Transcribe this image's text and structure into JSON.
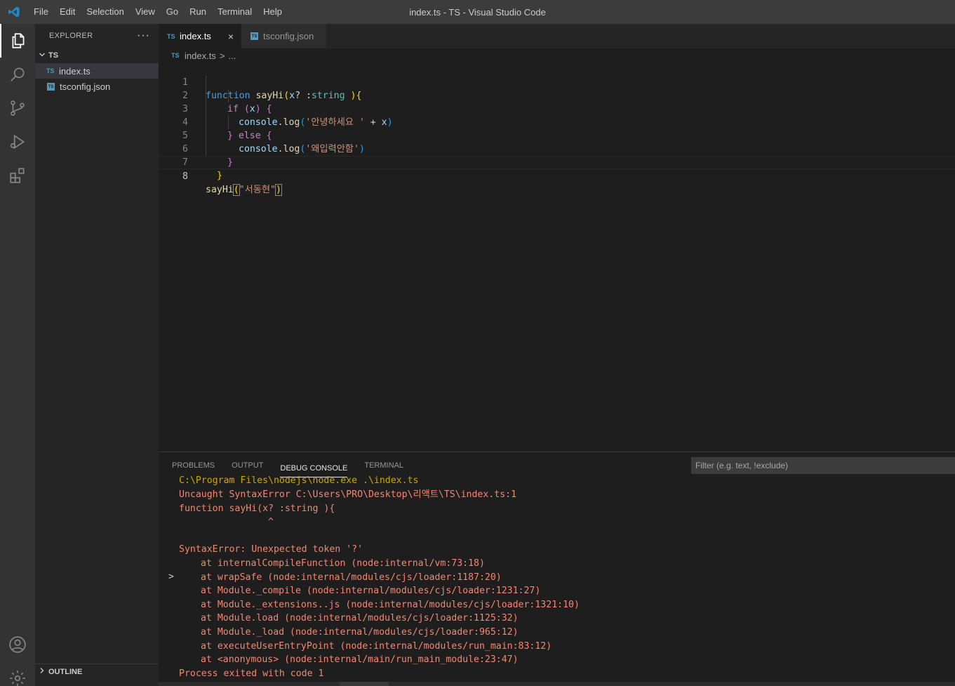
{
  "window": {
    "title": "index.ts - TS - Visual Studio Code",
    "menu": [
      "File",
      "Edit",
      "Selection",
      "View",
      "Go",
      "Run",
      "Terminal",
      "Help"
    ]
  },
  "activity_bar": {
    "items": [
      "files-icon",
      "search-icon",
      "source-control-icon",
      "run-debug-icon",
      "extensions-icon"
    ],
    "bottom": [
      "account-icon",
      "settings-gear-icon"
    ]
  },
  "sidebar": {
    "header": "EXPLORER",
    "more": "···",
    "folder": "TS",
    "files": [
      {
        "badge": "TS",
        "name": "index.ts",
        "selected": true
      },
      {
        "badge": "TS",
        "name": "tsconfig.json",
        "selected": false
      }
    ],
    "outline": "OUTLINE"
  },
  "tabs": [
    {
      "badge": "TS",
      "label": "index.ts",
      "active": true,
      "close": "×"
    },
    {
      "badge": "TS",
      "label": "tsconfig.json",
      "active": false
    }
  ],
  "breadcrumb": {
    "badge": "TS",
    "file": "index.ts",
    "sep": ">",
    "more": "..."
  },
  "editor": {
    "line_numbers": [
      "1",
      "2",
      "3",
      "4",
      "5",
      "6",
      "7",
      "8"
    ],
    "current_line": "8",
    "code": {
      "l1": {
        "kw": "function",
        "fn": "sayHi",
        "open": "(",
        "param": "x",
        "rest": "? :",
        "type": "string",
        "close": " )",
        "brace": "{"
      },
      "l2": {
        "kw": "if",
        "open": " (",
        "var": "x",
        "close": ")",
        "brace": " {"
      },
      "l3": {
        "obj": "console",
        "dot": ".",
        "fn": "log",
        "open": "(",
        "str": "'안녕하세요 '",
        "op": " + ",
        "var": "x",
        "close": ")"
      },
      "l4": {
        "brace1": "}",
        "kw": " else ",
        "brace2": "{"
      },
      "l5": {
        "obj": "console",
        "dot": ".",
        "fn": "log",
        "open": "(",
        "str": "'왜입력안함'",
        "close": ")"
      },
      "l6": {
        "brace": "}"
      },
      "l7": {
        "brace": "}"
      },
      "l8": {
        "fn": "sayHi",
        "open": "(",
        "str": "\"서동현\"",
        "close": ")"
      }
    }
  },
  "panel": {
    "tabs": [
      "PROBLEMS",
      "OUTPUT",
      "DEBUG CONSOLE",
      "TERMINAL"
    ],
    "active_tab": "DEBUG CONSOLE",
    "filter_placeholder": "Filter (e.g. text, !exclude)",
    "expander": ">",
    "console": [
      "C:\\Program Files\\nodejs\\node.exe .\\index.ts",
      "Uncaught SyntaxError C:\\Users\\PRO\\Desktop\\리액트\\TS\\index.ts:1",
      "function sayHi(x? :string ){",
      "                ^",
      "",
      "SyntaxError: Unexpected token '?'",
      "at internalCompileFunction (node:internal/vm:73:18)",
      "at wrapSafe (node:internal/modules/cjs/loader:1187:20)",
      "at Module._compile (node:internal/modules/cjs/loader:1231:27)",
      "at Module._extensions..js (node:internal/modules/cjs/loader:1321:10)",
      "at Module.load (node:internal/modules/cjs/loader:1125:32)",
      "at Module._load (node:internal/modules/cjs/loader:965:12)",
      "at executeUserEntryPoint (node:internal/modules/run_main:83:12)",
      "at <anonymous> (node:internal/main/run_main_module:23:47)",
      "Process exited with code 1"
    ]
  },
  "colors": {
    "titlebar": "#3c3c3c",
    "activitybar": "#333333",
    "sidebar": "#252526",
    "editor": "#1e1e1e",
    "accent_ts": "#519aba",
    "error_text": "#f48771",
    "command_text": "#cca700"
  }
}
